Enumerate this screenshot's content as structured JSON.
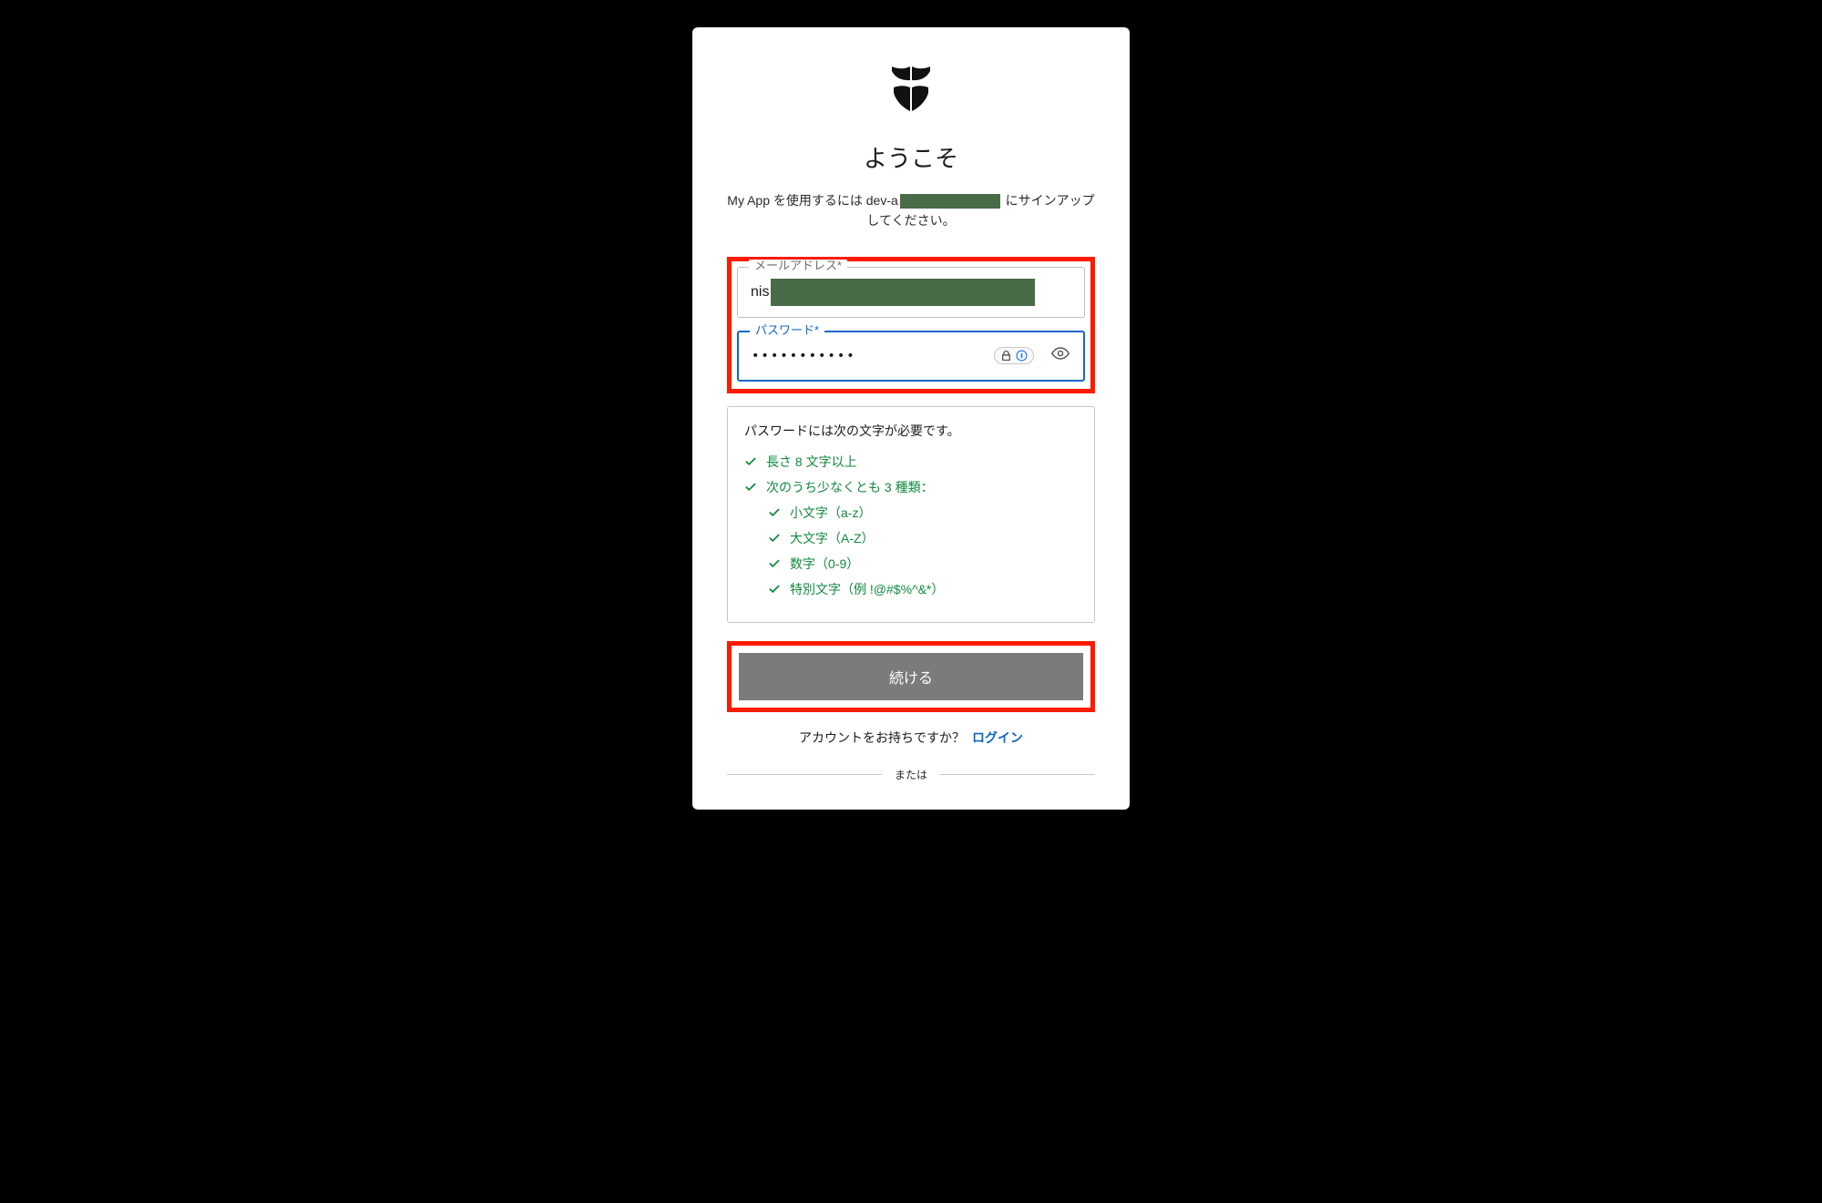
{
  "title": "ようこそ",
  "subtitle_pre": "My App を使用するには dev-a",
  "subtitle_post": " にサインアップしてください。",
  "email": {
    "label": "メールアドレス*",
    "value_prefix": "nis"
  },
  "password": {
    "label": "パスワード*",
    "masked": "•••••••••••"
  },
  "requirements": {
    "heading": "パスワードには次の文字が必要です。",
    "items": [
      {
        "text": "長さ 8 文字以上",
        "indent": false
      },
      {
        "text": "次のうち少なくとも 3 種類：",
        "indent": false
      },
      {
        "text": "小文字（a-z）",
        "indent": true
      },
      {
        "text": "大文字（A-Z）",
        "indent": true
      },
      {
        "text": "数字（0-9）",
        "indent": true
      },
      {
        "text": "特別文字（例 !@#$%^&*）",
        "indent": true
      }
    ]
  },
  "continue_label": "続ける",
  "login_prompt": "アカウントをお持ちですか？",
  "login_link": "ログイン",
  "divider_label": "または",
  "icons": {
    "lock": "lock-icon",
    "onepassword": "onepassword-icon",
    "eye": "eye-icon",
    "check": "check-icon",
    "shield_logo": "shield-logo"
  }
}
